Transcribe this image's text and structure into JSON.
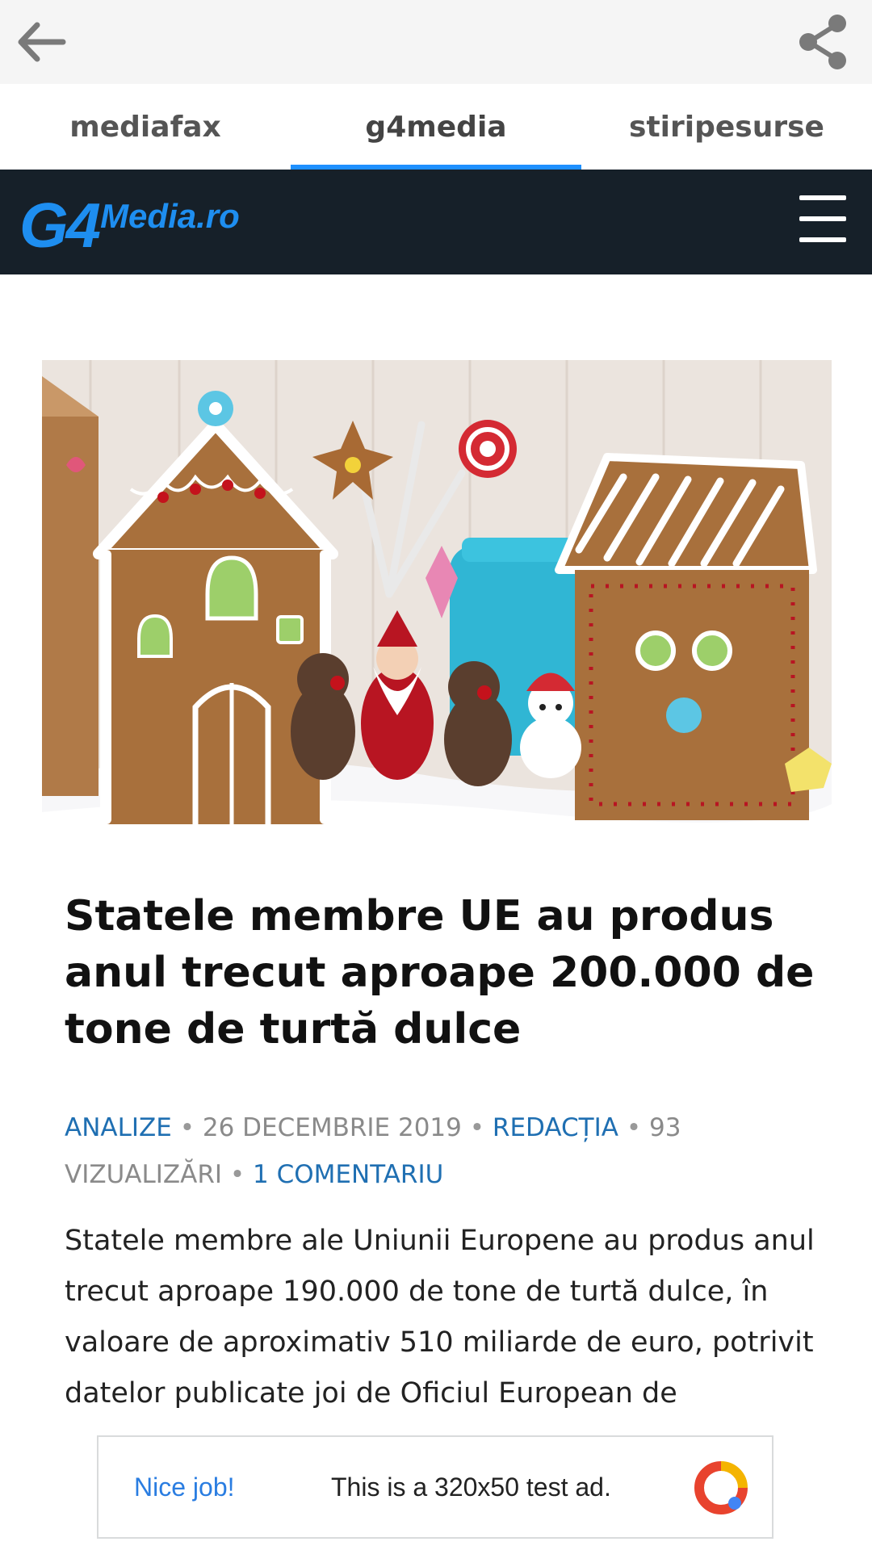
{
  "app_bar": {
    "back_icon": "arrow-left-icon",
    "share_icon": "share-icon"
  },
  "tabs": [
    {
      "label": "mediafax",
      "active": false
    },
    {
      "label": "g4media",
      "active": true
    },
    {
      "label": "stiripesurse",
      "active": false
    }
  ],
  "site_header": {
    "logo_main": "G4",
    "logo_suffix": "Media.ro",
    "menu_icon": "hamburger-menu-icon",
    "background": "#162029",
    "accent": "#1e8ef0"
  },
  "article": {
    "image_description_icon": "gingerbread-houses-image",
    "title": "Statele membre UE au produs anul trecut aproape 200.000 de tone de turtă dulce",
    "meta": {
      "category": "ANALIZE",
      "date": "26 DECEMBRIE 2019",
      "author": "REDACȚIA",
      "views": "93 VIZUALIZĂRI",
      "comments": "1 COMENTARIU",
      "separator": "•"
    },
    "body": "Statele membre ale Uniunii Europene au produs anul trecut aproape 190.000 de tone de turtă dulce, în valoare de aproximativ 510 miliarde de euro, potrivit datelor publicate joi de Oficiul European de"
  },
  "ad": {
    "label_left": "Nice job!",
    "label_main": "This is a 320x50 test ad.",
    "icon": "ad-choices-icon"
  }
}
